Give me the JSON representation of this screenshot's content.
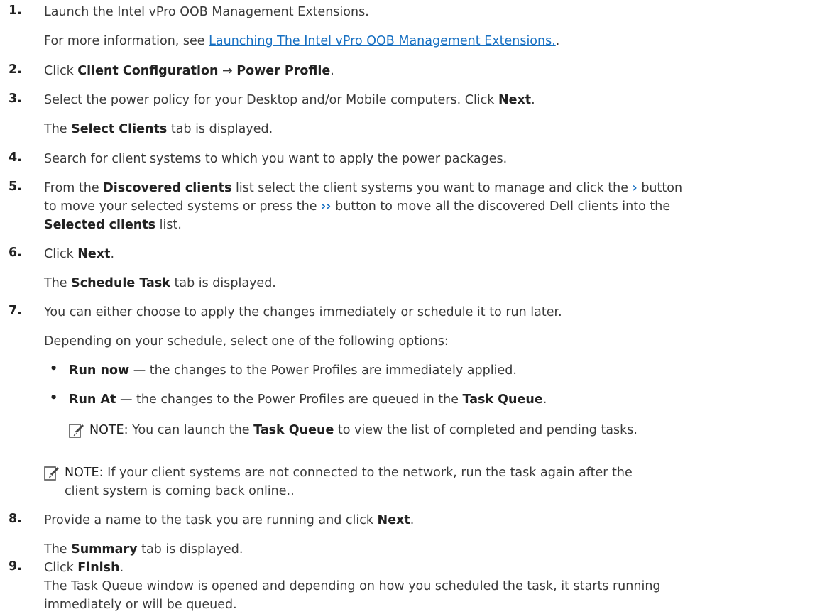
{
  "steps": [
    {
      "num": "1.",
      "a": "Launch the Intel vPro OOB Management Extensions.",
      "b_pre": "For more information, see ",
      "b_link": "Launching The Intel vPro OOB Management Extensions.",
      "b_post": "."
    },
    {
      "num": "2.",
      "pre": "Click ",
      "b1": "Client Configuration",
      "mid": " → ",
      "b2": "Power Profile",
      "post": "."
    },
    {
      "num": "3.",
      "pre": "Select the power policy for your Desktop and/or Mobile computers. Click ",
      "b1": "Next",
      "post": ".",
      "l2_pre": "The ",
      "l2_b": "Select Clients",
      "l2_post": " tab is displayed."
    },
    {
      "num": "4.",
      "text": "Search for client systems to which you want to apply the power packages."
    },
    {
      "num": "5.",
      "pre": "From the ",
      "b1": "Discovered clients",
      "mid1": " list select the client systems you want to manage and click the ",
      "chev1": "›",
      "post1": " button",
      "l2_pre": "to move your selected systems or press the ",
      "chev2": "››",
      "l2_post": " button to move all the discovered Dell clients into the",
      "l3_b": "Selected clients",
      "l3_post": " list."
    },
    {
      "num": "6.",
      "pre": "Click ",
      "b1": "Next",
      "post": ".",
      "l2_pre": "The ",
      "l2_b": "Schedule Task",
      "l2_post": " tab is displayed."
    },
    {
      "num": "7.",
      "text": "You can either choose to apply the changes immediately or schedule it to run later.",
      "l2": "Depending on your schedule, select one of the following options:",
      "bullets": [
        {
          "b": "Run now",
          "text": " — the changes to the Power Profiles are immediately applied."
        },
        {
          "b": "Run At",
          "text": " — the changes to the Power Profiles are queued in the ",
          "b2": "Task Queue",
          "post": "."
        }
      ],
      "note1_label": "NOTE:",
      "note1_pre": " You can launch the ",
      "note1_b": "Task Queue",
      "note1_post": " to view the list of completed and pending tasks.",
      "note2_label": "NOTE:",
      "note2_l1": " If your client systems are not connected to the network, run the task again after the",
      "note2_l2": "client system is coming back online.."
    },
    {
      "num": "8.",
      "pre": "Provide a name to the task you are running and click ",
      "b1": "Next",
      "post": ".",
      "l2_pre": "The ",
      "l2_b": "Summary",
      "l2_post": " tab is displayed."
    },
    {
      "num": "9.",
      "pre": "Click ",
      "b1": "Finish",
      "post": ".",
      "l2": "The Task Queue window is opened and depending on how you scheduled the task, it starts running",
      "l3": "immediately or will be queued."
    }
  ],
  "colors": {
    "link": "#1770c2",
    "text": "#3a3a3a"
  },
  "icons": {
    "note": "pencil-note-icon"
  }
}
